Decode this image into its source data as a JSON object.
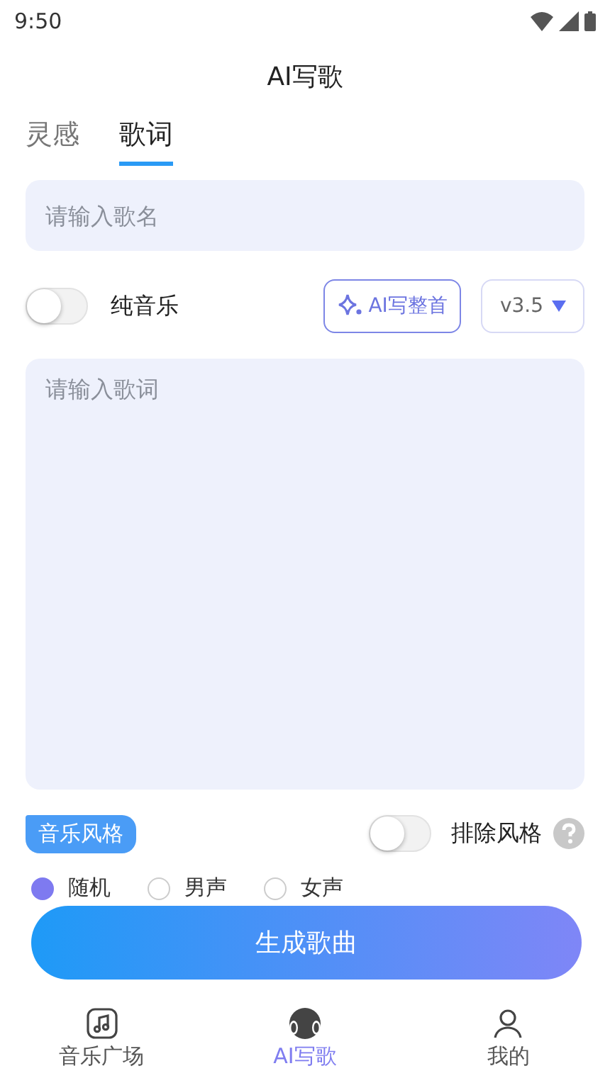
{
  "status_bar": {
    "time": "9:50"
  },
  "header": {
    "title": "AI写歌"
  },
  "tabs": [
    {
      "label": "灵感",
      "selected": false
    },
    {
      "label": "歌词",
      "selected": true
    }
  ],
  "song_name": {
    "placeholder": "请输入歌名"
  },
  "pure_music": {
    "label": "纯音乐",
    "on": false
  },
  "ai_write_button": "AI写整首",
  "version": {
    "value": "v3.5"
  },
  "lyrics": {
    "placeholder": "请输入歌词"
  },
  "style": {
    "tag": "音乐风格",
    "exclude_label": "排除风格",
    "exclude_on": false
  },
  "voices": [
    {
      "label": "随机",
      "selected": true
    },
    {
      "label": "男声",
      "selected": false
    },
    {
      "label": "女声",
      "selected": false
    }
  ],
  "generate_button": "生成歌曲",
  "nav": [
    {
      "label": "音乐广场",
      "kind": "note",
      "selected": false
    },
    {
      "label": "AI写歌",
      "kind": "ai",
      "selected": true
    },
    {
      "label": "我的",
      "kind": "person",
      "selected": false
    }
  ]
}
